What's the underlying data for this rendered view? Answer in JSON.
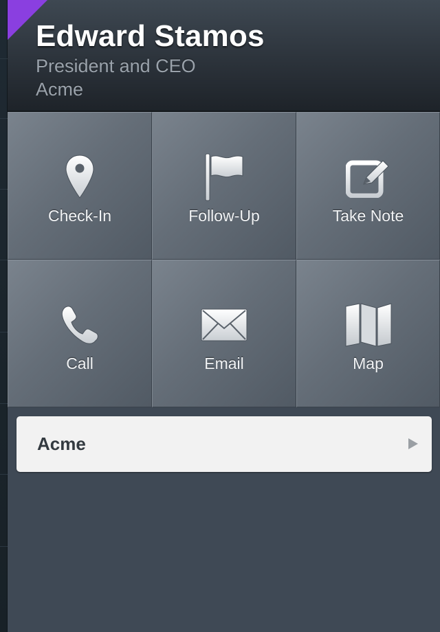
{
  "contact": {
    "name": "Edward Stamos",
    "title": "President and CEO",
    "company": "Acme"
  },
  "actions": [
    {
      "label": "Check-In",
      "icon": "location-pin-icon"
    },
    {
      "label": "Follow-Up",
      "icon": "flag-icon"
    },
    {
      "label": "Take Note",
      "icon": "note-edit-icon"
    },
    {
      "label": "Call",
      "icon": "phone-icon"
    },
    {
      "label": "Email",
      "icon": "envelope-icon"
    },
    {
      "label": "Map",
      "icon": "map-icon"
    }
  ],
  "related": {
    "account_label": "Acme",
    "chevron_icon": "disclosure-arrow-icon"
  },
  "colors": {
    "accent_flag": "#8a3fe0",
    "panel_background": "#3f4955",
    "tile_top": "#7a838d",
    "row_background": "#f2f2f2"
  }
}
